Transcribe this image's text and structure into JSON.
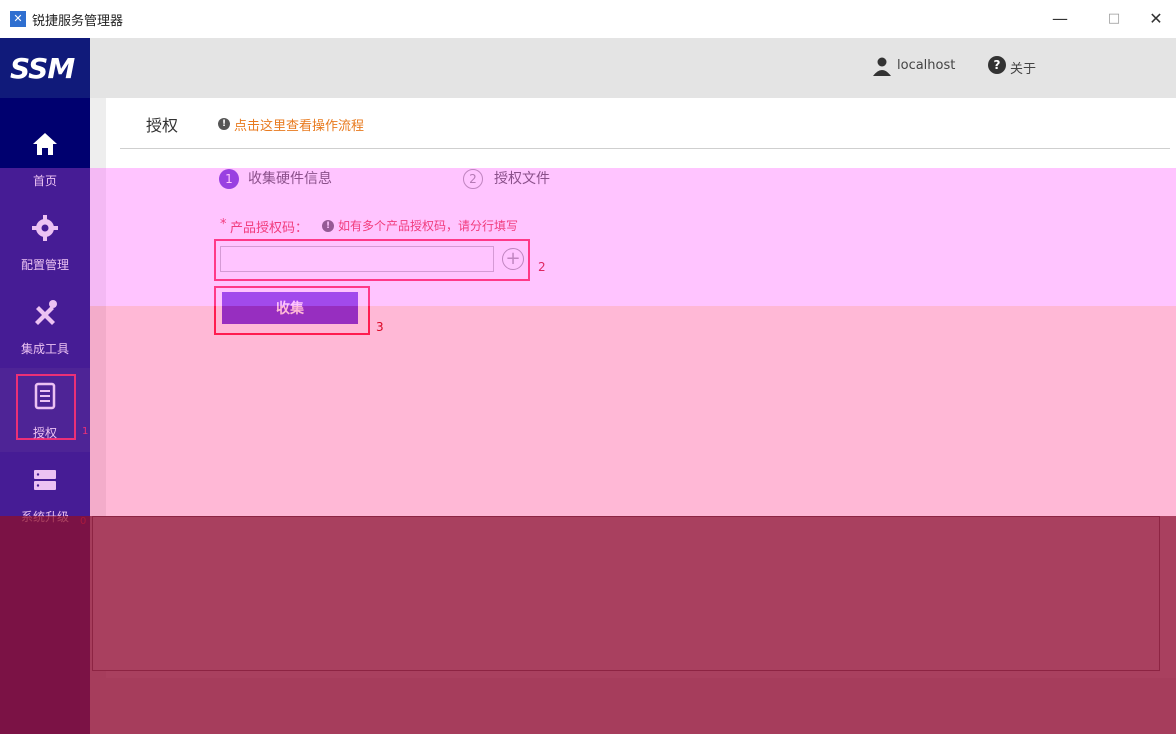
{
  "window": {
    "title": "锐捷服务管理器",
    "minimize": "—",
    "maximize": "□",
    "close": "✕"
  },
  "sidebar": {
    "logo": "SSM",
    "items": [
      {
        "label": "首页",
        "icon": "home-icon"
      },
      {
        "label": "配置管理",
        "icon": "gear-icon"
      },
      {
        "label": "集成工具",
        "icon": "tools-icon"
      },
      {
        "label": "授权",
        "icon": "license-icon"
      },
      {
        "label": "系统升级",
        "icon": "server-icon"
      }
    ],
    "active": "授权",
    "markers": [
      "1",
      "0"
    ]
  },
  "header": {
    "user": "localhost",
    "about": "关于"
  },
  "page": {
    "title": "授权",
    "help_link": "点击这里查看操作流程",
    "steps": [
      {
        "num": "1",
        "label": "收集硬件信息",
        "active": true
      },
      {
        "num": "2",
        "label": "授权文件",
        "active": false
      }
    ],
    "field": {
      "required_mark": "*",
      "label": "产品授权码：",
      "hint": "如有多个产品授权码，请分行填写",
      "value": "",
      "add": "+"
    },
    "collect_button": "收集",
    "annotation_marks": [
      "2",
      "3"
    ]
  },
  "colors": {
    "sidebar_bg": "#00006f",
    "accent": "#6a3ae0",
    "warning": "#e8252e",
    "link": "#e87a1e",
    "highlight_frame": "#ff2040"
  }
}
